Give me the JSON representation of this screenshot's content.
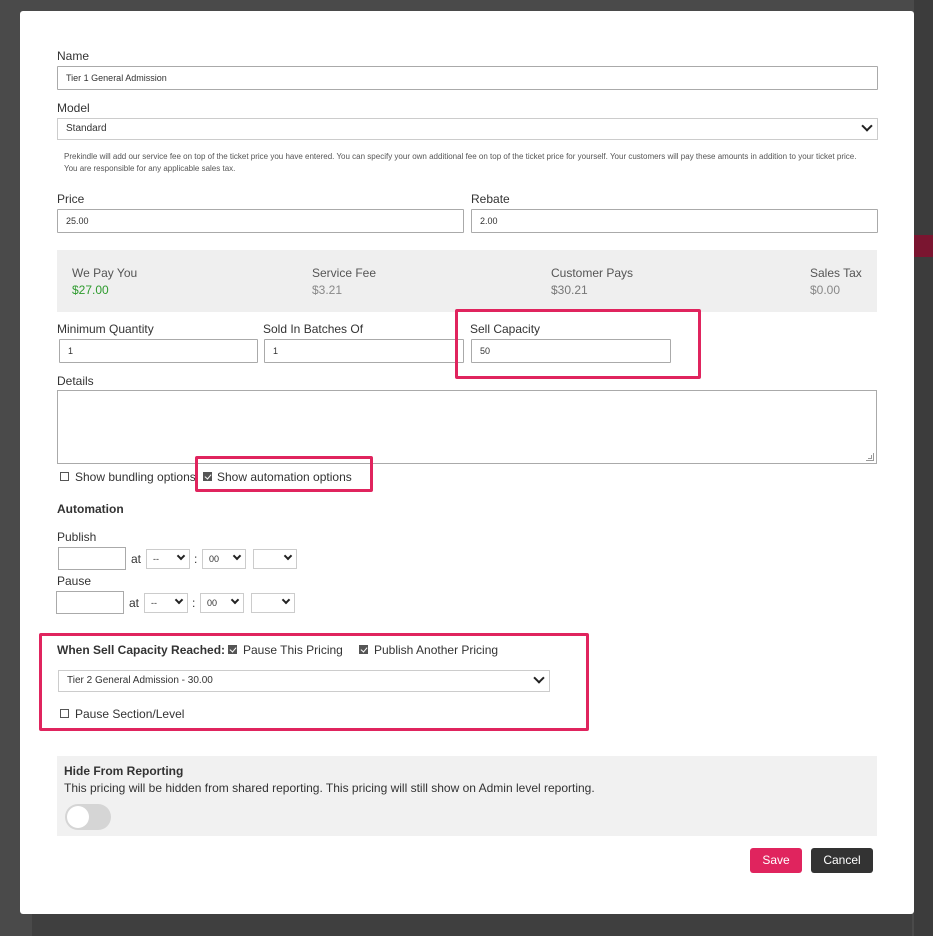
{
  "form": {
    "name_label": "Name",
    "name_value": "Tier 1 General Admission",
    "model_label": "Model",
    "model_value": "Standard",
    "help_text": "Prekindle will add our service fee on top of the ticket price you have entered. You can specify your own additional fee on top of the ticket price for yourself. Your customers will pay these amounts in addition to your ticket price. You are responsible for any applicable sales tax.",
    "price_label": "Price",
    "price_value": "25.00",
    "rebate_label": "Rebate",
    "rebate_value": "2.00",
    "min_qty_label": "Minimum Quantity",
    "min_qty_value": "1",
    "batches_label": "Sold In Batches Of",
    "batches_value": "1",
    "sell_capacity_label": "Sell Capacity",
    "sell_capacity_value": "50",
    "details_label": "Details",
    "show_bundling_label": "Show bundling options",
    "show_automation_label": "Show automation options"
  },
  "summary": {
    "we_pay_you_label": "We Pay You",
    "we_pay_you_value": "$27.00",
    "service_fee_label": "Service Fee",
    "service_fee_value": "$3.21",
    "customer_pays_label": "Customer Pays",
    "customer_pays_value": "$30.21",
    "sales_tax_label": "Sales Tax",
    "sales_tax_value": "$0.00"
  },
  "automation": {
    "heading": "Automation",
    "publish_label": "Publish",
    "pause_label": "Pause",
    "at_label": "at",
    "colon": ":",
    "hour_placeholder": "--",
    "minute_value": "00",
    "capacity_reached_label": "When Sell Capacity Reached:",
    "pause_this_pricing_label": "Pause This Pricing",
    "publish_another_label": "Publish Another Pricing",
    "another_pricing_value": "Tier 2 General Admission - 30.00",
    "pause_section_label": "Pause Section/Level"
  },
  "reporting": {
    "title": "Hide From Reporting",
    "description": "This pricing will be hidden from shared reporting. This pricing will still show on Admin level reporting."
  },
  "buttons": {
    "save": "Save",
    "cancel": "Cancel"
  },
  "colors": {
    "accent": "#e0245e",
    "positive": "#2e9b2e"
  }
}
